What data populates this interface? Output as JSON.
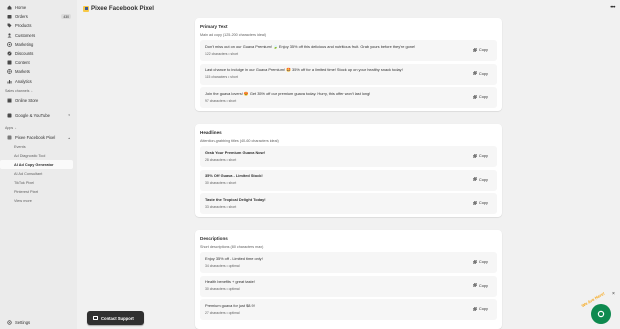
{
  "sidebar": {
    "items": [
      {
        "label": "Home",
        "icon": "home-icon"
      },
      {
        "label": "Orders",
        "icon": "orders-icon",
        "badge": "430"
      },
      {
        "label": "Products",
        "icon": "tag-icon"
      },
      {
        "label": "Customers",
        "icon": "person-icon"
      },
      {
        "label": "Marketing",
        "icon": "target-icon"
      },
      {
        "label": "Discounts",
        "icon": "discount-icon"
      },
      {
        "label": "Content",
        "icon": "content-icon"
      },
      {
        "label": "Markets",
        "icon": "globe-icon"
      },
      {
        "label": "Analytics",
        "icon": "bar-chart-icon"
      }
    ],
    "sales_channels_label": "Sales channels",
    "online_store": "Online Store",
    "google_youtube": "Google & YouTube",
    "apps_label": "Apps",
    "app_name": "Pixee Facebook Pixel",
    "app_sub_items": [
      "Events",
      "Ad Diagnostic Tool",
      "AI Ad Copy Generator",
      "AI Ad Consultant",
      "TikTok Pixel",
      "Pinterest Pixel",
      "View more"
    ],
    "active_sub_item": "AI Ad Copy Generator",
    "settings": "Settings"
  },
  "header": {
    "title": "Pixee Facebook Pixel",
    "more": "•••"
  },
  "primary_text": {
    "heading": "Primary Text",
    "subheading": "Main ad copy (125-200 characters ideal)",
    "items": [
      {
        "text": "Don't miss out on our Guava Premium! 🍃 Enjoy 35% off this delicious and nutritious fruit. Grab yours before they're gone!",
        "meta": "122 characters • short"
      },
      {
        "text": "Last chance to indulge in our Guava Premium! 🤩 35% off for a limited time! Stock up on your healthy snack today!",
        "meta": "115 characters • short"
      },
      {
        "text": "Join the guava lovers! 😍 Get 35% off our premium guava today. Hurry, this offer won't last long!",
        "meta": "97 characters • short"
      }
    ]
  },
  "headlines": {
    "heading": "Headlines",
    "subheading": "Attention-grabbing titles (40-60 characters ideal)",
    "items": [
      {
        "text": "Grab Your Premium Guava Now!",
        "meta": "28 characters • short"
      },
      {
        "text": "35% Off Guava - Limited Stock!",
        "meta": "30 characters • short"
      },
      {
        "text": "Taste the Tropical Delight Today!",
        "meta": "33 characters • short"
      }
    ]
  },
  "descriptions": {
    "heading": "Descriptions",
    "subheading": "Short descriptions (80 characters max)",
    "items": [
      {
        "text": "Enjoy 35% off - Limited time only!",
        "meta": "34 characters • optimal"
      },
      {
        "text": "Health benefits + great taste!",
        "meta": "30 characters • optimal"
      },
      {
        "text": "Premium guava for just $8.9!",
        "meta": "27 characters • optimal"
      }
    ]
  },
  "copy_label": "Copy",
  "contact_support": "Contact Support",
  "chat": {
    "greeting": "We Are Here!",
    "close": "×"
  },
  "colors": {
    "sidebar": "#ebebeb",
    "card": "#ffffff",
    "row": "#f6f6f6",
    "contact_button": "#303030",
    "chat_green": "#0e8a4f"
  }
}
